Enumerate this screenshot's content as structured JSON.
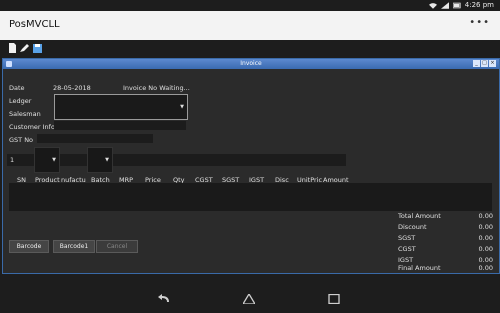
{
  "status_bar": {
    "time": "4:26",
    "time_suffix": "pm"
  },
  "app": {
    "title": "PosMVCLL",
    "overflow_label": "•••"
  },
  "window": {
    "title": "Invoice",
    "controls": [
      "_",
      "□",
      "×"
    ]
  },
  "form": {
    "date_label": "Date",
    "date_value": "28-05-2018",
    "invoice_status": "Invoice No Waiting...",
    "ledger_label": "Ledger",
    "salesman_label": "Salesman",
    "customer_info_label": "Customer Info",
    "gst_label": "GST No",
    "qty_value": "1"
  },
  "table": {
    "headers": [
      "SN",
      "Product",
      "nufactu",
      "Batch",
      "MRP",
      "Price",
      "Qty",
      "CGST",
      "SGST",
      "IGST",
      "Disc",
      "UnitPric",
      "Amount"
    ]
  },
  "summary": [
    {
      "label": "Total Amount",
      "value": "0.00"
    },
    {
      "label": "Discount",
      "value": "0.00"
    },
    {
      "label": "SGST",
      "value": "0.00"
    },
    {
      "label": "CGST",
      "value": "0.00"
    },
    {
      "label": "IGST",
      "value": "0.00"
    },
    {
      "label": "Final Amount",
      "value": "0.00"
    }
  ],
  "buttons": {
    "barcode": "Barcode",
    "barcode1": "Barcode1",
    "cancel": "Cancel"
  },
  "colors": {
    "titlebar": "#4a7cc4",
    "background": "#2b2b2b",
    "appbar": "#f3f3f3"
  }
}
